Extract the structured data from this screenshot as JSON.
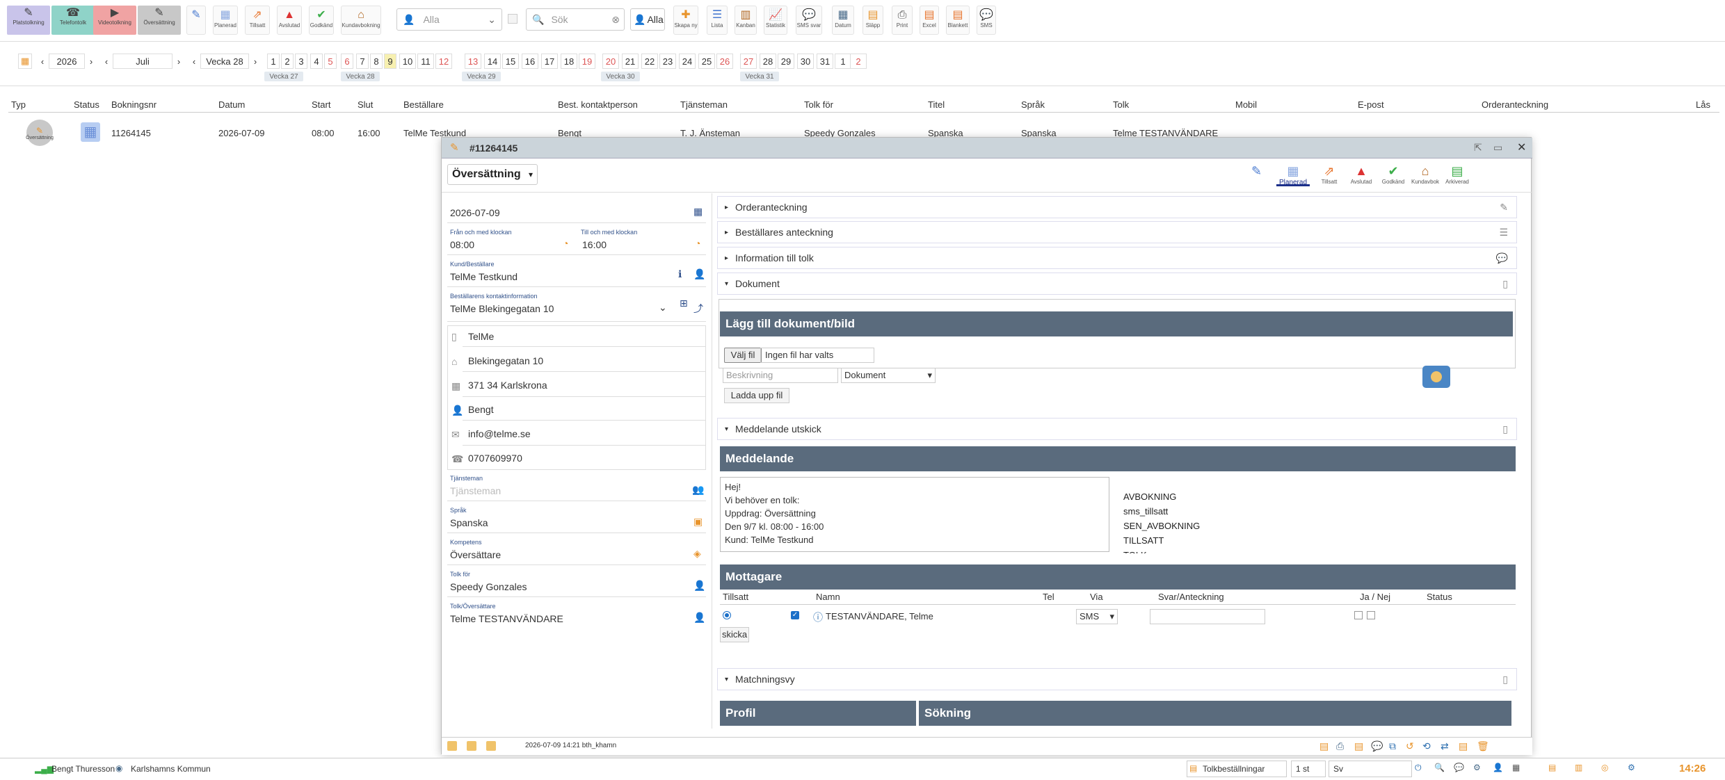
{
  "toolbar": {
    "services": [
      {
        "label": "Platstolkning",
        "color": "#c9c4ea"
      },
      {
        "label": "Telefontolk",
        "color": "#8fd3c8"
      },
      {
        "label": "Videotolkning",
        "color": "#f0a3a3"
      },
      {
        "label": "Översättning",
        "color": "#c8c8c8"
      }
    ],
    "buttons": [
      "",
      "Planerad",
      "Tillsatt",
      "Avslutad",
      "Godkänd",
      "Kundavbokning"
    ],
    "filter_value": "Alla",
    "search_placeholder": "Sök",
    "alla_label": "Alla",
    "right_buttons": [
      "Skapa ny",
      "Lista",
      "Kanban",
      "Statistik",
      "SMS svar",
      "Datum",
      "Släpp",
      "Print",
      "Excel",
      "Blankett",
      "SMS"
    ]
  },
  "calendar": {
    "year": "2026",
    "month": "Juli",
    "week": "Vecka 28",
    "days": [
      "1",
      "2",
      "3",
      "4",
      "5",
      "6",
      "7",
      "8",
      "9",
      "10",
      "11",
      "12",
      "13",
      "14",
      "15",
      "16",
      "17",
      "18",
      "19",
      "20",
      "21",
      "22",
      "23",
      "24",
      "25",
      "26",
      "27",
      "28",
      "29",
      "30",
      "31",
      "1",
      "2"
    ],
    "weeks": [
      "Vecka 27",
      "Vecka 28",
      "Vecka 29",
      "Vecka 30",
      "Vecka 31"
    ]
  },
  "grid": {
    "headers": [
      "Typ",
      "Status",
      "Bokningsnr",
      "Datum",
      "Start",
      "Slut",
      "Beställare",
      "Best. kontaktperson",
      "Tjänsteman",
      "Tolk för",
      "Titel",
      "Språk",
      "Tolk",
      "Mobil",
      "E-post",
      "Orderanteckning",
      "Lås"
    ],
    "row": {
      "typ": "Översättning",
      "bokningsnr": "11264145",
      "datum": "2026-07-09",
      "start": "08:00",
      "slut": "16:00",
      "bestallare": "TelMe Testkund",
      "kontakt": "Bengt",
      "tjansteman": "T. J. Änsteman",
      "tolkfor": "Speedy Gonzales",
      "titel": "Spanska",
      "sprak": "Spanska",
      "tolk": "Telme TESTANVÄNDARE"
    }
  },
  "modal": {
    "title": "#11264145",
    "type": "Översättning",
    "statuses": [
      {
        "label": "Planerad"
      },
      {
        "label": "Tillsatt"
      },
      {
        "label": "Avslutad"
      },
      {
        "label": "Godkänd"
      },
      {
        "label": "Kundavbok"
      },
      {
        "label": "Arkiverad"
      }
    ],
    "date": "2026-07-09",
    "from_label": "Från och med klockan",
    "from": "08:00",
    "to_label": "Till och med klockan",
    "to": "16:00",
    "kund_label": "Kund/Beställare",
    "kund": "TelMe Testkund",
    "kontakt_label": "Beställarens kontaktinformation",
    "kontakt": "TelMe Blekingegatan 10",
    "company": "TelMe",
    "street": "Blekingegatan 10",
    "city": "371 34 Karlskrona",
    "person": "Bengt",
    "email": "info@telme.se",
    "phone": "0707609970",
    "tjansteman_label": "Tjänsteman",
    "tjansteman_placeholder": "Tjänsteman",
    "sprak_label": "Språk",
    "sprak": "Spanska",
    "kompetens_label": "Kompetens",
    "kompetens": "Översättare",
    "tolkfor_label": "Tolk för",
    "tolkfor": "Speedy Gonzales",
    "tolk_label": "Tolk/Översättare",
    "tolk": "Telme TESTANVÄNDARE",
    "sections": {
      "order": "Orderanteckning",
      "best": "Beställares anteckning",
      "info": "Information till tolk",
      "dok": "Dokument",
      "medd": "Meddelande utskick",
      "match": "Matchningsvy"
    },
    "dok_band": "Lägg till dokument/bild",
    "file_button": "Välj fil",
    "file_status": "Ingen fil har valts",
    "beskrivning_placeholder": "Beskrivning",
    "dok_type": "Dokument",
    "upload_button": "Ladda upp fil",
    "medd_band": "Meddelande",
    "message_lines": [
      "Hej!",
      "Vi behöver en tolk:",
      "Uppdrag: Översättning",
      "Den 9/7 kl. 08:00 - 16:00",
      "Kund: TelMe Testkund"
    ],
    "templates": [
      "AVBOKNING",
      "sms_tillsatt",
      "SEN_AVBOKNING",
      "TILLSATT",
      "TOLK"
    ],
    "mottagare_band": "Mottagare",
    "recv_headers": [
      "Tillsatt",
      "Namn",
      "Tel",
      "Via",
      "Svar/Anteckning",
      "Ja / Nej",
      "Status"
    ],
    "recv_name": "TESTANVÄNDARE, Telme",
    "recv_via": "SMS",
    "send_button": "skicka",
    "profil_band": "Profil",
    "sokning_band": "Sökning",
    "footer_info": "2026-07-09 14:21 bth_khamn"
  },
  "footer": {
    "user": "Bengt Thuresson",
    "org": "Karlshamns Kommun",
    "queue": "Tolkbeställningar",
    "count": "1 st",
    "lang": "Sv",
    "time": "14:26"
  }
}
